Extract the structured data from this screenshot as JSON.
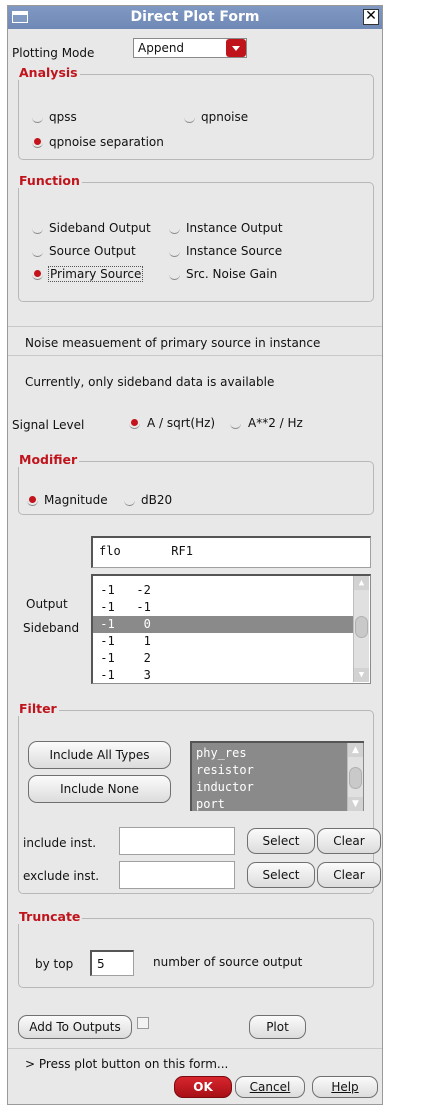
{
  "window": {
    "title": "Direct Plot Form",
    "close_glyph": "✕"
  },
  "plotting_mode": {
    "label": "Plotting Mode",
    "value": "Append"
  },
  "analysis": {
    "title": "Analysis",
    "options": [
      "qpss",
      "qpnoise",
      "qpnoise separation"
    ],
    "selected": "qpnoise separation"
  },
  "function": {
    "title": "Function",
    "options": [
      "Sideband Output",
      "Instance Output",
      "Source Output",
      "Instance Source",
      "Primary Source",
      "Src. Noise Gain"
    ],
    "selected": "Primary Source"
  },
  "info": {
    "line1": "Noise measuement of primary source in instance",
    "line2": "Currently, only sideband data is available"
  },
  "signal_level": {
    "label": "Signal Level",
    "options": [
      "A / sqrt(Hz)",
      "A**2 / Hz"
    ],
    "selected": "A / sqrt(Hz)"
  },
  "modifier": {
    "title": "Modifier",
    "options": [
      "Magnitude",
      "dB20"
    ],
    "selected": "Magnitude"
  },
  "sideband": {
    "header": "flo       RF1",
    "label1": "Output",
    "label2": "Sideband",
    "rows": [
      " -1   -2",
      " -1   -1",
      " -1    0",
      " -1    1",
      " -1    2",
      " -1    3"
    ],
    "selected_index": 2
  },
  "filter": {
    "title": "Filter",
    "include_all_label": "Include All Types",
    "include_none_label": "Include None",
    "types": [
      "phy_res",
      "resistor",
      "inductor",
      "port"
    ],
    "include_label": "include inst.",
    "exclude_label": "exclude inst.",
    "select_label": "Select",
    "clear_label": "Clear",
    "include_value": "",
    "exclude_value": ""
  },
  "truncate": {
    "title": "Truncate",
    "by_top_label": "by top",
    "value": "5",
    "suffix": "number of source output"
  },
  "actions": {
    "add_to_outputs": "Add To Outputs",
    "plot": "Plot",
    "status": "> Press plot button on this form...",
    "ok": "OK",
    "cancel": "Cancel",
    "help": "Help"
  },
  "colors": {
    "accent": "#c0141c",
    "title_bar": "#7390bd",
    "selection": "#8a8a8a"
  }
}
